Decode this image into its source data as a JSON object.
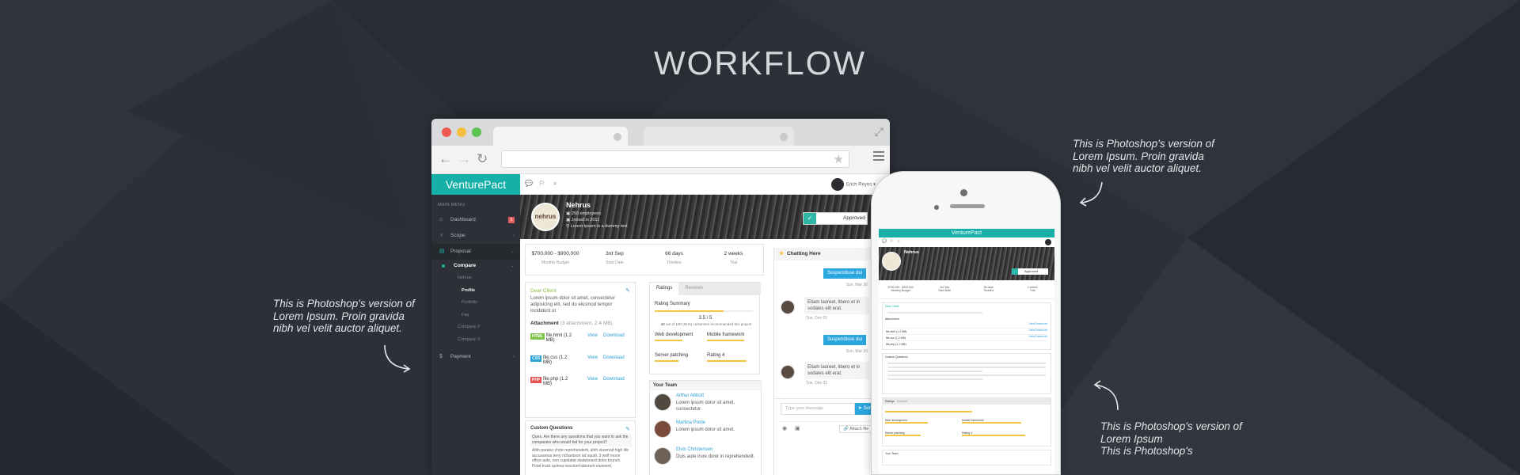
{
  "page": {
    "heading": "WORKFLOW"
  },
  "notes": {
    "top_right": "This is Photoshop's version  of\nLorem Ipsum. Proin gravida\nnibh vel velit auctor aliquet.",
    "left": "This is Photoshop's version  of\nLorem Ipsum. Proin gravida\nnibh vel velit auctor aliquet.",
    "bottom_right": "This is Photoshop's version  of\nLorem Ipsum\nThis is Photoshop's"
  },
  "colors": {
    "brand": "#17b0a8",
    "sidebar": "#2d3036",
    "link": "#2a9fd6",
    "accent_bar": "#f4c543"
  },
  "app": {
    "brand": "VenturePact",
    "user_name": "Erich Reyes",
    "sidebar": {
      "menu_label": "MAIN MENU",
      "items": [
        {
          "label": "Dashboard",
          "icon": "home-icon",
          "badge": "5"
        },
        {
          "label": "Scope",
          "icon": "bulb-icon"
        },
        {
          "label": "Proposal",
          "icon": "document-icon"
        },
        {
          "label": "Compare"
        },
        {
          "label": "Nehrus"
        },
        {
          "label": "Profile"
        },
        {
          "label": "Portfolio"
        },
        {
          "label": "Faq"
        },
        {
          "label": "Company 2"
        },
        {
          "label": "Company 3"
        },
        {
          "label": "Payment",
          "icon": "dollar-icon"
        }
      ]
    },
    "profile": {
      "logo_text": "nehrus",
      "name": "Nehrus",
      "employees": "250 employees",
      "joined": "Joined in 2011",
      "location": "Lorem Ipsum is a dummy text",
      "status": "Approved"
    },
    "stats": [
      {
        "value": "$700,000 - $900,000",
        "label": "Monthly Budget"
      },
      {
        "value": "3rd Sep",
        "label": "Start Date"
      },
      {
        "value": "66 days",
        "label": "Timeline"
      },
      {
        "value": "2 weeks",
        "label": "Trial"
      }
    ],
    "letter": {
      "greeting": "Dear Client",
      "body": "Lorem ipsum dolor sit amet, consectetur adipisicing elit, sed do eiusmod tempor incididunt ut",
      "attachment_label": "Attachment",
      "attachment_meta": "(3 attachment, 2.4 MB)",
      "files": [
        {
          "tag": "HTML",
          "name": "file.html (1.2 MB)",
          "view": "View",
          "download": "Download"
        },
        {
          "tag": "CSS",
          "name": "file.css (1.2 MB)",
          "view": "View",
          "download": "Download"
        },
        {
          "tag": "PHP",
          "name": "file.php (1.2 MB)",
          "view": "View",
          "download": "Download"
        }
      ]
    },
    "custom_questions": {
      "title": "Custom Questions",
      "q1": "Ques. Are there any questions that you want to ask the companies who would bid for your project?",
      "a1": "Ahih paratur chrte reprehenderit, ahih eiusmod high life accusamus terry richardson ad squid. 3 wolf moon office aute, non cupidatat skateboard dolor brunch. Food truck quinoa nesciunt laborum eiusmod."
    },
    "ratings": {
      "tabs": [
        "Ratings",
        "Reviews"
      ],
      "summary_label": "Rating Summary",
      "score": "3.5 / 5",
      "caption_bold": "40",
      "caption": "out of 100 (91%) customers recommended this project",
      "items": [
        {
          "label": "Web development",
          "fill": 0.6
        },
        {
          "label": "Mobile framework",
          "fill": 0.75
        },
        {
          "label": "Server patching",
          "fill": 0.5
        },
        {
          "label": "Rating 4",
          "fill": 0.8
        }
      ]
    },
    "team": {
      "title": "Your Team",
      "members": [
        {
          "name": "Arthur Abbott",
          "text": "Lorem ipsum dolor sit amet, consectetur."
        },
        {
          "name": "Martina Poole",
          "text": "Lorem ipsum dolor sit amet."
        },
        {
          "name": "Elvis Christensen",
          "text": "Duis aute irure dolor in reprehenderit."
        }
      ]
    },
    "chat": {
      "title": "Chatting Here",
      "messages": [
        {
          "side": "right",
          "text": "Suspendisse dui",
          "time": "Sun, Mar 30"
        },
        {
          "side": "left",
          "text": "Etiam laoreet, libero et in sodales elit erat.",
          "time": "Tue, Dec 01"
        },
        {
          "side": "right",
          "text": "Suspendisse dui",
          "time": "Sun, Mar 30"
        },
        {
          "side": "left",
          "text": "Etiam laoreet, libero et in sodales elit erat.",
          "time": "Tue, Dec 01"
        }
      ],
      "input_placeholder": "Type your message",
      "send_label": "Send",
      "attach_label": "Attach file"
    }
  },
  "phone": {
    "brand": "VenturePact",
    "name": "Nehrus",
    "status": "Approved",
    "stats": [
      {
        "value": "$700,000 - $900,000",
        "label": "Monthly Budget"
      },
      {
        "value": "3rd Sep",
        "label": "Start Date"
      },
      {
        "value": "66 days",
        "label": "Timeline"
      },
      {
        "value": "2 weeks",
        "label": "Trial"
      }
    ],
    "greeting": "Dear Client",
    "attachment_label": "Attachment",
    "files": [
      "file.html (1.2 MB)",
      "file.css (1.2 MB)",
      "file.php (1.2 MB)"
    ],
    "view": "View",
    "download": "Download",
    "questions_label": "Custom Questions",
    "tabs": [
      "Ratings",
      "Reviews"
    ],
    "rating_items": [
      "Web development",
      "Mobile framework",
      "Server patching",
      "Rating 4"
    ],
    "team_label": "Your Team"
  }
}
